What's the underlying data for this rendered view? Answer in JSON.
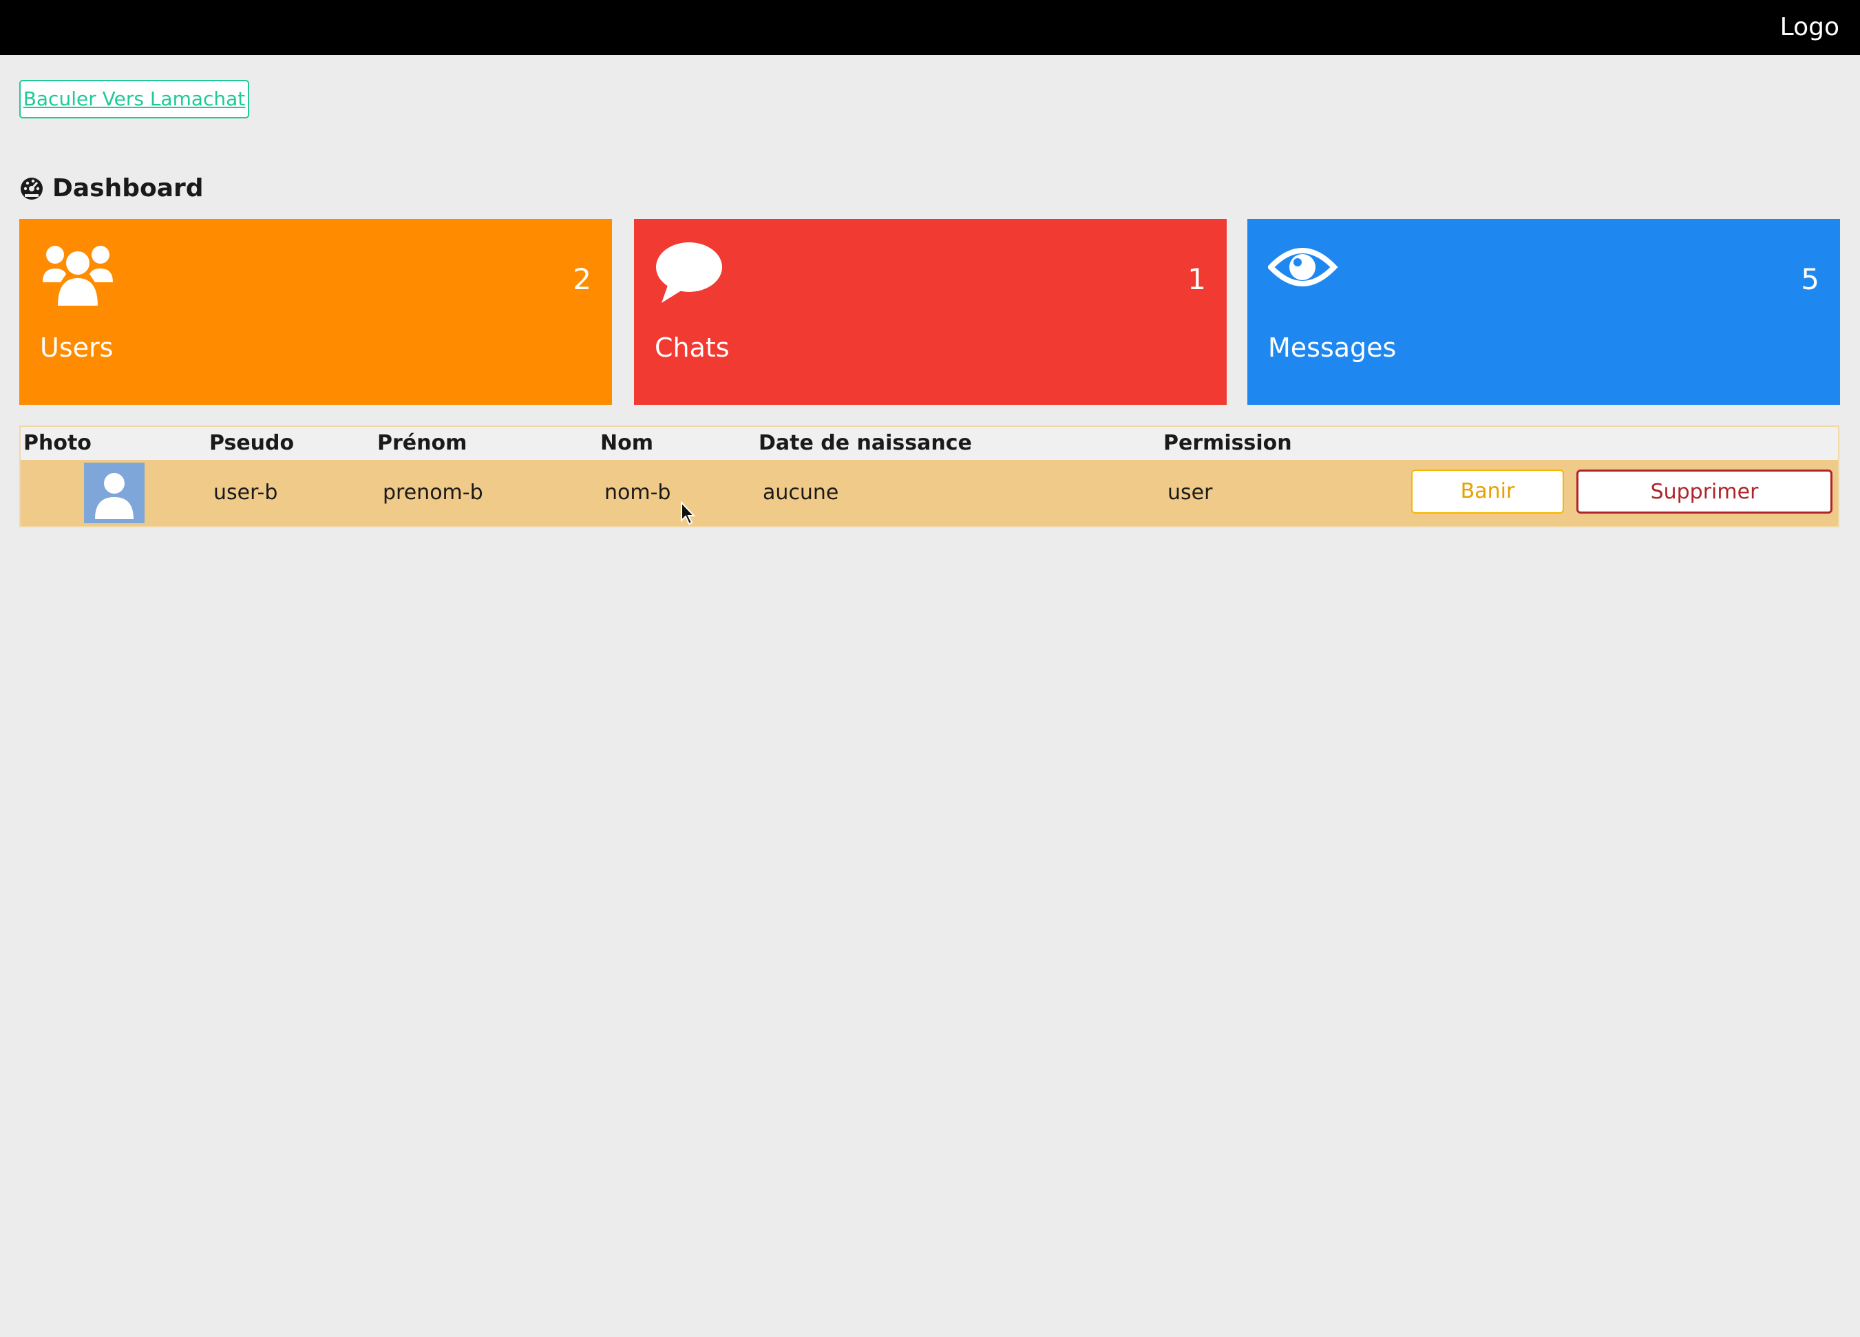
{
  "topbar": {
    "logo": "Logo"
  },
  "switch_link": "Baculer Vers Lamachat",
  "page": {
    "title": "Dashboard",
    "icon": "tachometer-icon"
  },
  "cards": {
    "users": {
      "label": "Users",
      "count": "2",
      "icon": "users-icon",
      "color": "#ff8c00"
    },
    "chats": {
      "label": "Chats",
      "count": "1",
      "icon": "comment-icon",
      "color": "#f03a32"
    },
    "messages": {
      "label": "Messages",
      "count": "5",
      "icon": "eye-icon",
      "color": "#1f88f0"
    }
  },
  "table": {
    "headers": [
      "Photo",
      "Pseudo",
      "Prénom",
      "Nom",
      "Date de naissance",
      "Permission"
    ],
    "rows": [
      {
        "photo": "user-avatar-icon",
        "pseudo": "user-b",
        "prenom": "prenom-b",
        "nom": "nom-b",
        "date_naissance": "aucune",
        "permission": "user",
        "actions": {
          "ban": "Banir",
          "delete": "Supprimer"
        }
      }
    ]
  },
  "colors": {
    "topbar": "#000000",
    "link": "#20c997",
    "row_highlight": "#f0ca88",
    "ban": "#f5b800",
    "delete": "#b0232a"
  }
}
